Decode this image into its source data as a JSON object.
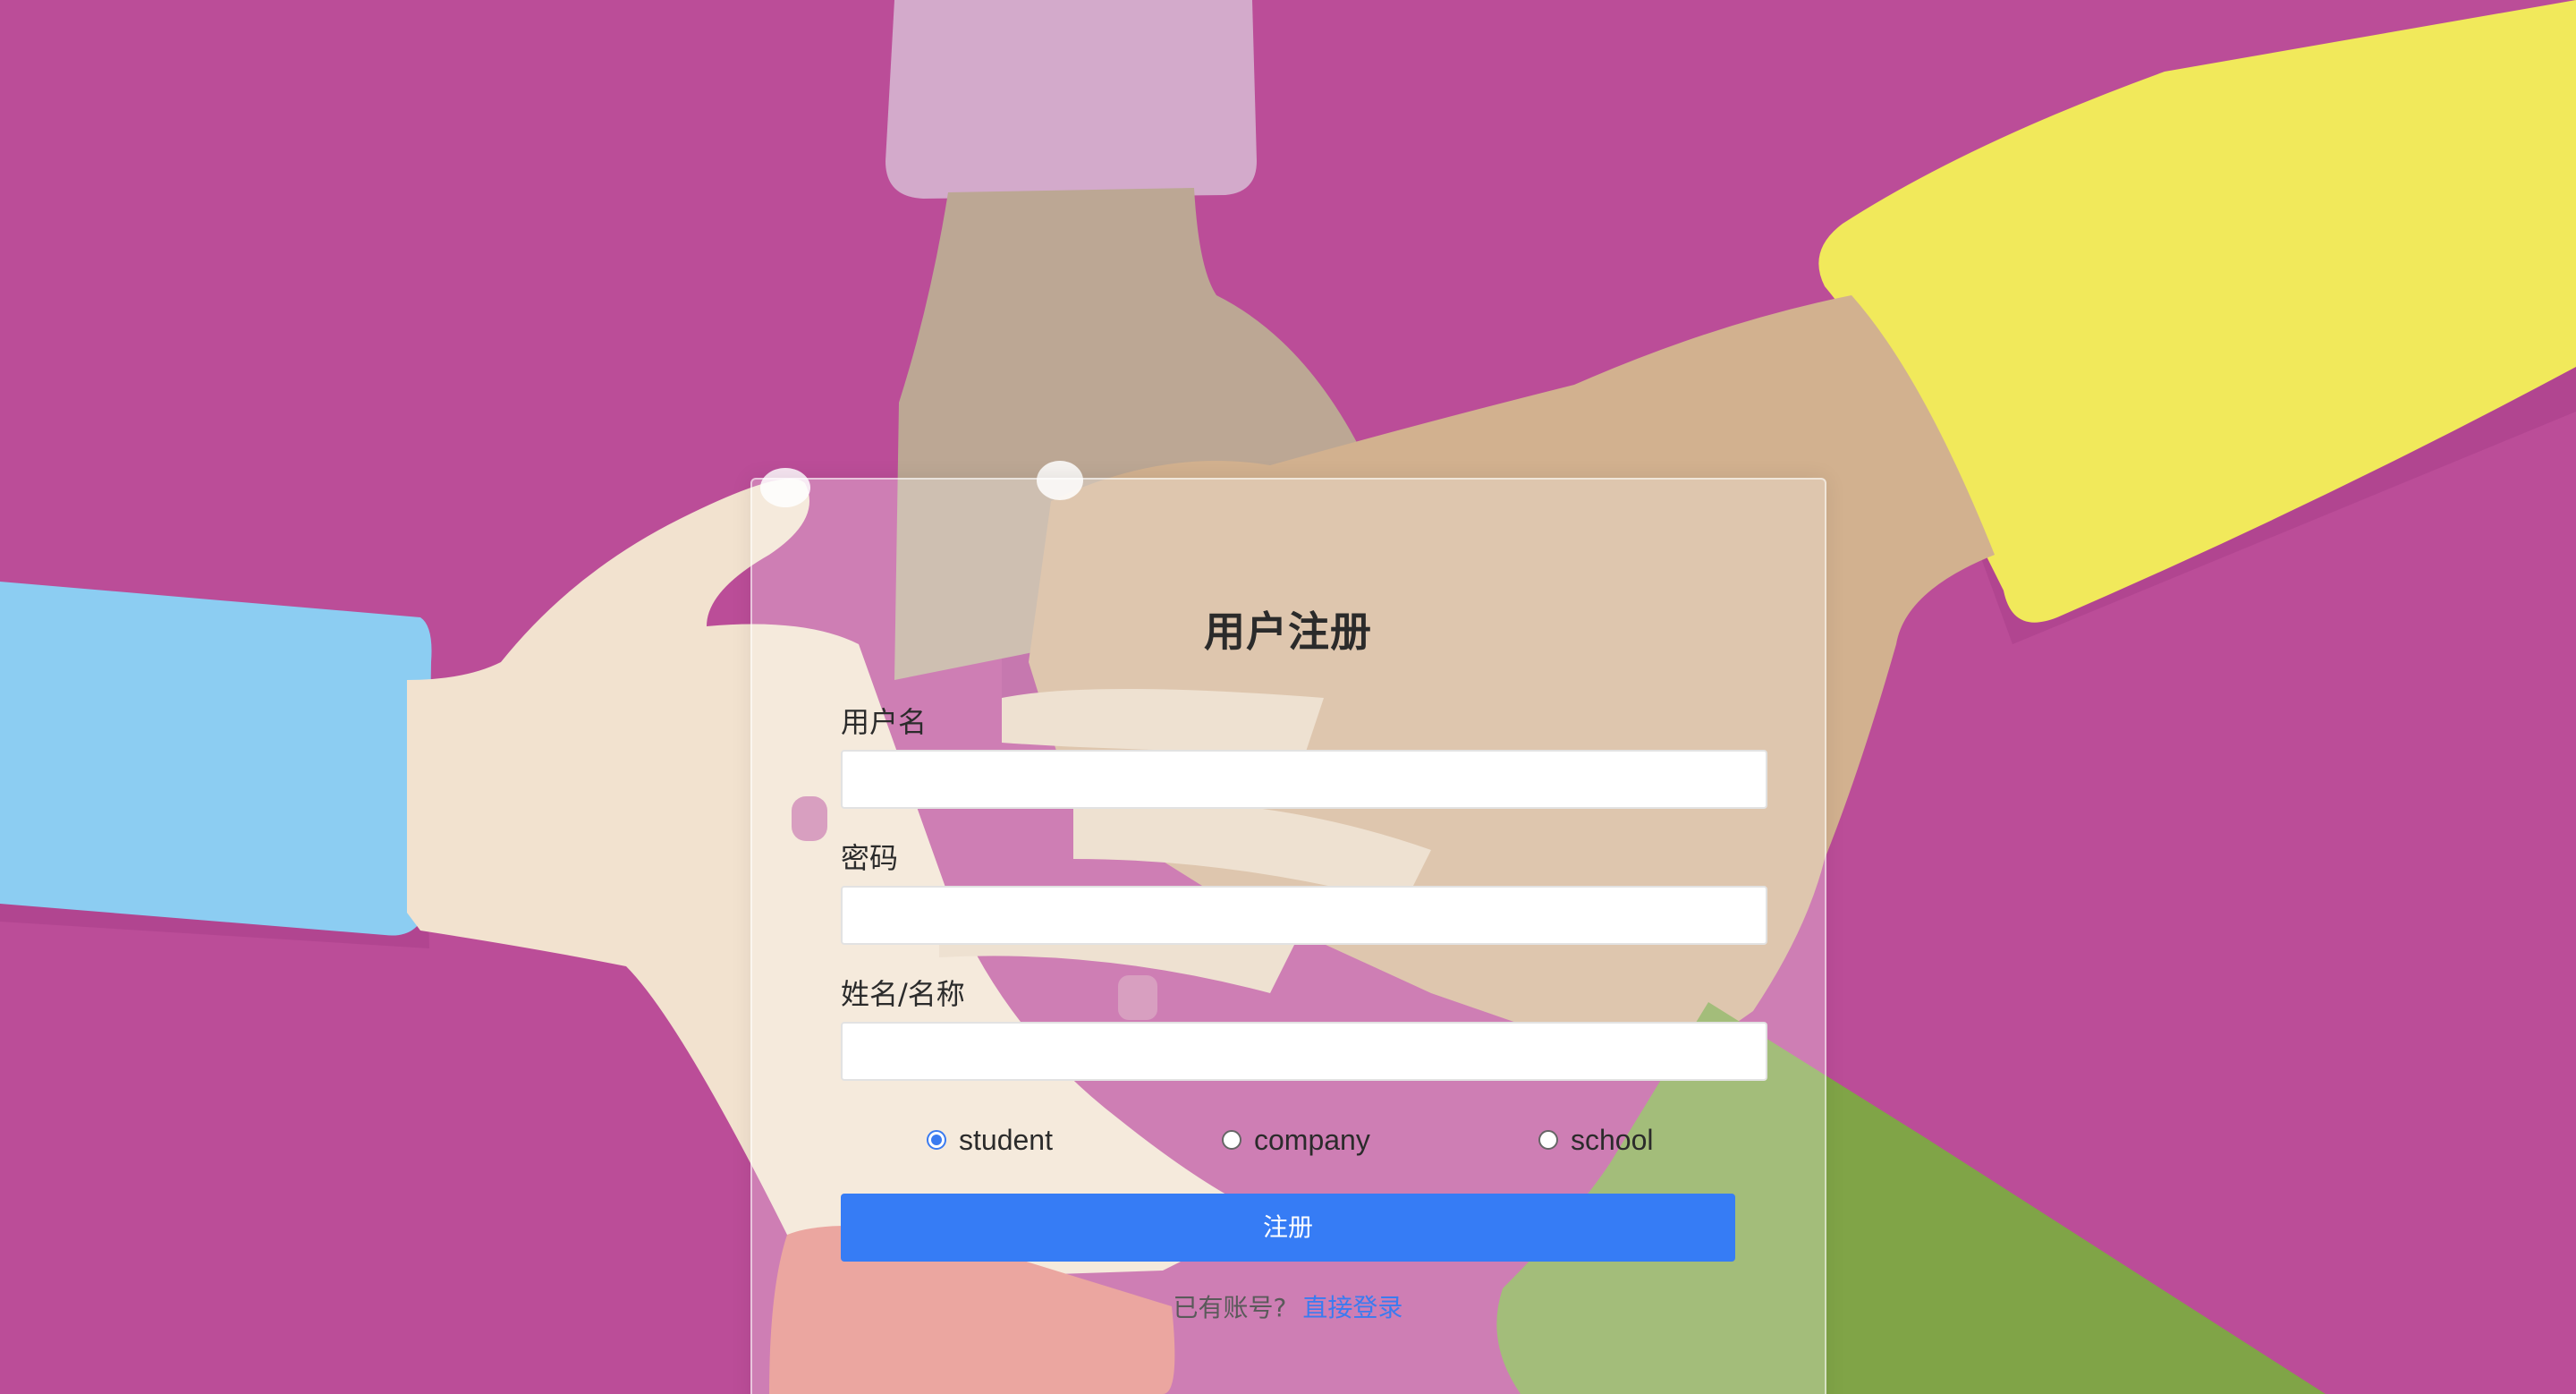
{
  "form": {
    "title": "用户注册",
    "fields": [
      {
        "label": "用户名",
        "value": "",
        "type": "text"
      },
      {
        "label": "密码",
        "value": "",
        "type": "password"
      },
      {
        "label": "姓名/名称",
        "value": "",
        "type": "text"
      }
    ],
    "roles": [
      {
        "label": "student",
        "checked": true
      },
      {
        "label": "company",
        "checked": false
      },
      {
        "label": "school",
        "checked": false
      }
    ],
    "submit_label": "注册",
    "login_prompt": "已有账号?",
    "login_link": "直接登录"
  },
  "colors": {
    "background": "#bb4d98",
    "primary_button": "#367cf5",
    "link": "#3a7bf0"
  }
}
